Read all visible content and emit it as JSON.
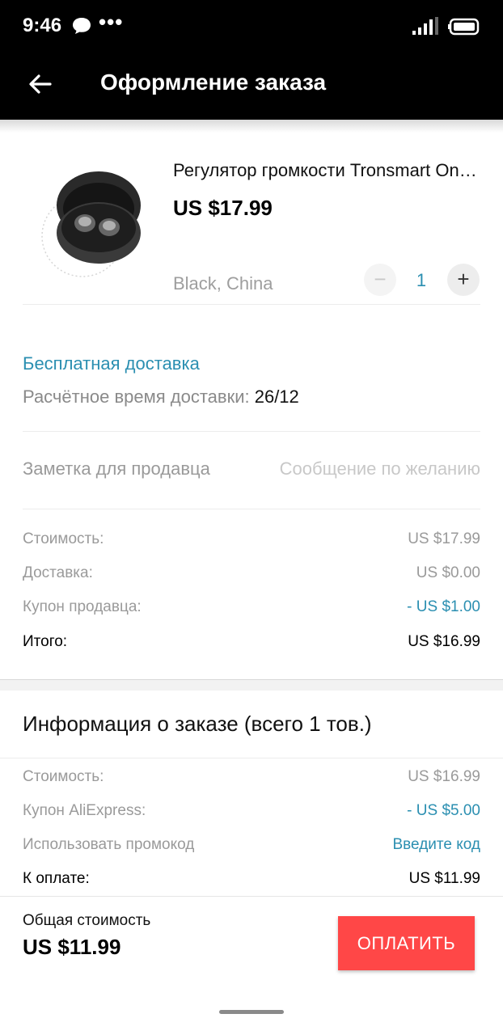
{
  "status_bar": {
    "time": "9:46",
    "icons": [
      "chat-bubble-icon",
      "more-dots-icon",
      "signal-icon",
      "battery-icon"
    ],
    "dots": "•••"
  },
  "header": {
    "back_icon": "arrow-left-icon",
    "title": "Оформление заказа"
  },
  "product": {
    "name": "Регулятор громкости Tronsmart Onyx Neo",
    "price": "US $17.99",
    "variant": "Black, China",
    "quantity": "1",
    "minus_label": "−",
    "plus_label": "+"
  },
  "shipping": {
    "method": "Бесплатная доставка",
    "estimate_label": "Расчётное время доставки: ",
    "estimate_date": "26/12"
  },
  "seller_note": {
    "label": "Заметка для продавца",
    "placeholder": "Сообщение по желанию"
  },
  "item_summary": [
    {
      "label": "Стоимость:",
      "value": "US $17.99"
    },
    {
      "label": "Доставка:",
      "value": "US $0.00"
    },
    {
      "label": "Купон продавца:",
      "value": "- US $1.00"
    },
    {
      "label": "Итого:",
      "value": "US $16.99"
    }
  ],
  "order_info": {
    "title": "Информация о заказе (всего 1 тов.)",
    "rows": [
      {
        "label": "Стоимость:",
        "value": "US $16.99"
      },
      {
        "label": "Купон AliExpress:",
        "value": "- US $5.00"
      },
      {
        "label": "Использовать промокод",
        "value": "Введите код"
      },
      {
        "label": "К оплате:",
        "value": "US $11.99"
      }
    ]
  },
  "footer": {
    "total_label": "Общая стоимость",
    "total_value": "US $11.99",
    "pay_button": "ОПЛАТИТЬ"
  },
  "colors": {
    "accent_blue": "#2b8fb1",
    "pay_red": "#ff4747",
    "header_bg": "#000000"
  }
}
